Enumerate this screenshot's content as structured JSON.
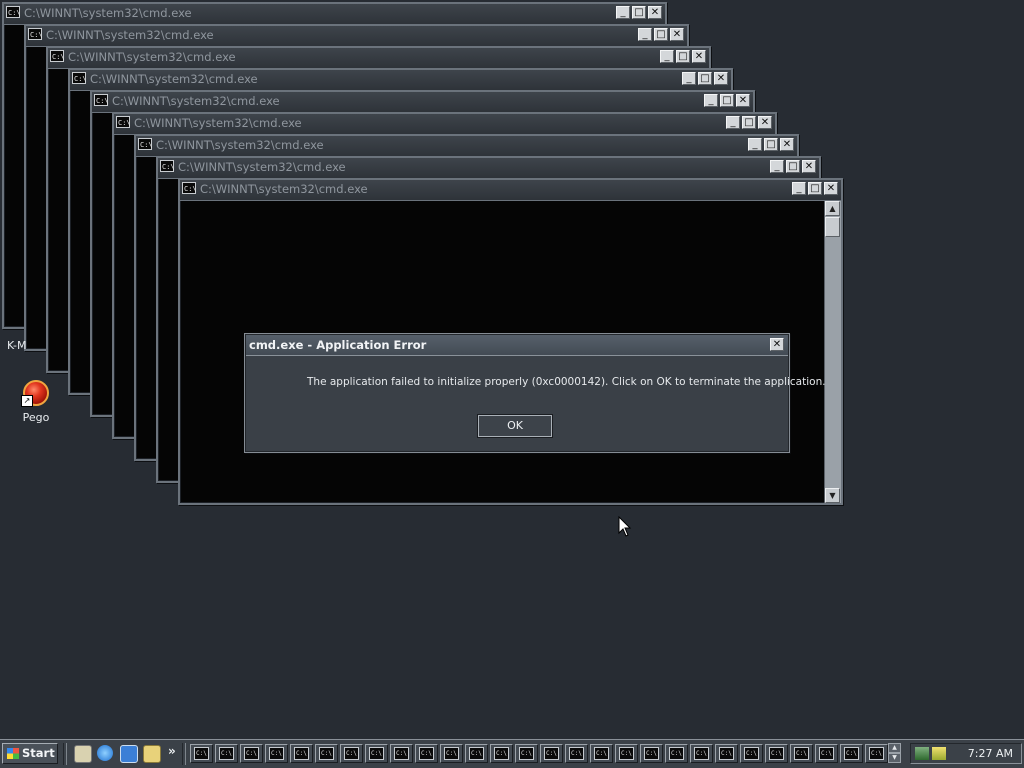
{
  "cmd_windows": {
    "title": "C:\\WINNT\\system32\\cmd.exe",
    "icon_text": "C:\\",
    "count": 9
  },
  "desktop": {
    "partial_icon_label": "K-M",
    "pego_label": "Pego"
  },
  "error_dialog": {
    "title": "cmd.exe - Application Error",
    "message": "The application failed to initialize properly (0xc0000142). Click on OK to terminate the application.",
    "ok_label": "OK",
    "close_glyph": "✕"
  },
  "taskbar": {
    "start_label": "Start",
    "overflow_glyph": "»",
    "task_count": 28,
    "task_icon_text": "C:\\",
    "clock": "7:27 AM"
  },
  "colors": {
    "desktop": "#272c33",
    "titlebar": "#3e444b",
    "console": "#050505",
    "dialog": "#3a4047"
  }
}
